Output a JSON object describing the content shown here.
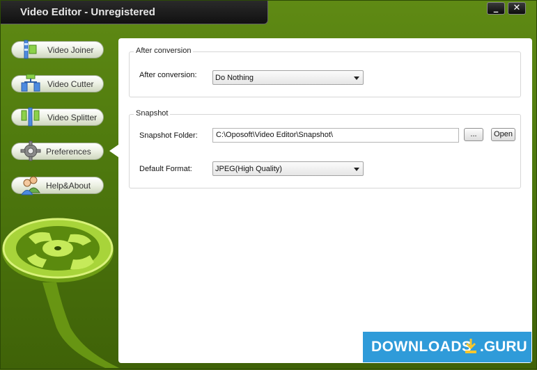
{
  "window": {
    "title": "Video Editor - Unregistered",
    "min_label": "_",
    "close_label": "✕"
  },
  "nav": [
    {
      "label": "Video Joiner",
      "icon": "video-joiner-icon"
    },
    {
      "label": "Video Cutter",
      "icon": "video-cutter-icon"
    },
    {
      "label": "Video Splitter",
      "icon": "video-splitter-icon"
    },
    {
      "label": "Preferences",
      "icon": "gear-icon",
      "selected": true
    },
    {
      "label": "Help&About",
      "icon": "users-icon"
    }
  ],
  "after_conversion": {
    "group_title": "After conversion",
    "label": "After conversion:",
    "value": "Do Nothing"
  },
  "snapshot": {
    "group_title": "Snapshot",
    "folder_label": "Snapshot Folder:",
    "folder_value": "C:\\Oposoft\\Video Editor\\Snapshot\\",
    "browse_label": "...",
    "open_label": "Open",
    "format_label": "Default Format:",
    "format_value": "JPEG(High Quality)"
  },
  "watermark": {
    "text": "DOWNLOADS",
    "suffix": ".GURU"
  },
  "colors": {
    "accent": "#5f8a14",
    "panel": "#ffffff",
    "watermark": "#1e93d6"
  }
}
